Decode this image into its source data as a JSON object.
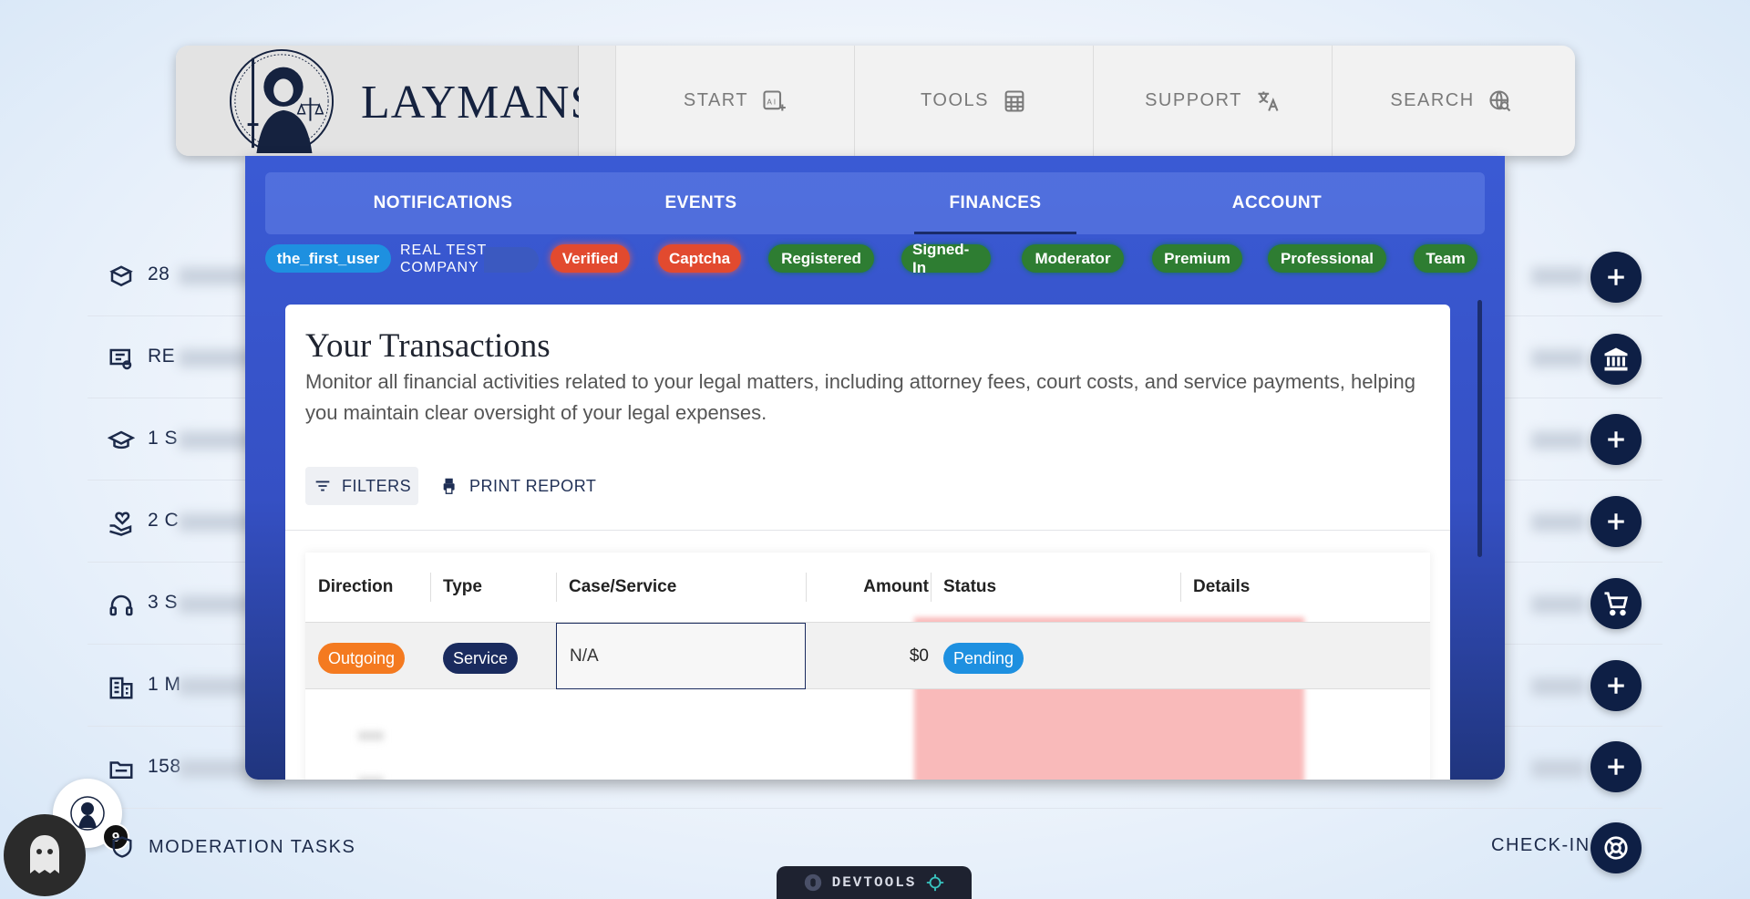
{
  "brand": {
    "name": "LAYMANS"
  },
  "nav": [
    {
      "label": "START",
      "icon": "ai-sparkle-icon"
    },
    {
      "label": "TOOLS",
      "icon": "calculator-icon"
    },
    {
      "label": "SUPPORT",
      "icon": "translate-icon"
    },
    {
      "label": "SEARCH",
      "icon": "search-globe-icon"
    }
  ],
  "tabs": [
    {
      "label": "NOTIFICATIONS"
    },
    {
      "label": "EVENTS"
    },
    {
      "label": "FINANCES",
      "active": true
    },
    {
      "label": "ACCOUNT"
    }
  ],
  "user": {
    "username": "the_first_user",
    "company": "REAL TEST COMPANY",
    "badges": [
      "Verified",
      "Captcha",
      "Registered",
      "Signed-In",
      "Moderator",
      "Premium",
      "Professional",
      "Team"
    ]
  },
  "transactions": {
    "title": "Your Transactions",
    "description": "Monitor all financial activities related to your legal matters, including attorney fees, court costs, and service payments, helping you maintain clear oversight of your legal expenses.",
    "filters_label": "FILTERS",
    "print_label": "PRINT REPORT",
    "columns": [
      "Direction",
      "Type",
      "Case/Service",
      "Amount",
      "Status",
      "Details"
    ],
    "rows": [
      {
        "direction": "Outgoing",
        "type": "Service",
        "case": "N/A",
        "amount": "$0",
        "status": "Pending"
      }
    ]
  },
  "background_list": [
    {
      "label": "28",
      "icon": "box-hand-icon",
      "action": "plus-icon"
    },
    {
      "label": "RE",
      "icon": "certificate-icon",
      "action": "bank-icon"
    },
    {
      "label": "1 S",
      "icon": "graduation-cap-icon",
      "action": "plus-icon"
    },
    {
      "label": "2 C",
      "icon": "hand-heart-icon",
      "action": "plus-icon"
    },
    {
      "label": "3 S",
      "icon": "headset-icon",
      "action": "cart-icon"
    },
    {
      "label": "1 M",
      "icon": "building-icon",
      "action": "plus-icon"
    },
    {
      "label": "158",
      "icon": "folder-icon",
      "action": "plus-icon"
    }
  ],
  "footer": {
    "moderation_label": "MODERATION TASKS",
    "badge_count": "9",
    "checkin_label": "CHECK-IN",
    "devtools_label": "DEVTOOLS"
  },
  "colors": {
    "panel": "#3a5ad4",
    "verified": "#e24a2f",
    "green_badge": "#2e7d32",
    "outgoing": "#f47a20",
    "service": "#1a2b5e",
    "pending": "#1e90e0",
    "fab": "#0e1f45"
  }
}
